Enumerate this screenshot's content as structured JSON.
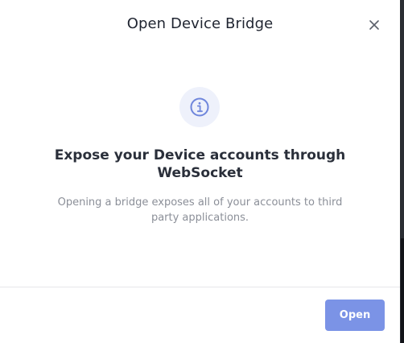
{
  "dialog": {
    "title": "Open Device Bridge",
    "close_icon": "close-icon",
    "info_icon": "info-icon",
    "heading": "Expose your Device accounts through WebSocket",
    "description": "Opening a bridge exposes all of your accounts to third party applications.",
    "open_label": "Open"
  },
  "colors": {
    "accent": "#7b93e6",
    "icon_background": "#eef1fb",
    "heading_text": "#2a2f3a",
    "muted_text": "#8b8f98"
  }
}
